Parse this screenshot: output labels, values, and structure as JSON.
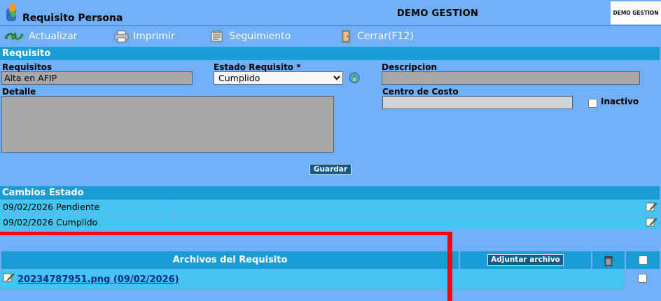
{
  "window": {
    "title": "Requisito Persona",
    "company": "DEMO GESTION",
    "brand": "DEMO GESTION"
  },
  "toolbar": {
    "update_label": "Actualizar",
    "print_label": "Imprimir",
    "follow_label": "Seguimiento",
    "close_label": "Cerrar(F12)"
  },
  "requisito": {
    "section_title": "Requisito",
    "requisitos_label": "Requisitos",
    "requisitos_value": "Alta en AFIP",
    "estado_label": "Estado Requisito *",
    "estado_value": "Cumplido",
    "descripcion_label": "Descripcion",
    "descripcion_value": "",
    "detalle_label": "Detalle",
    "detalle_value": "",
    "centro_label": "Centro de Costo",
    "centro_value": "",
    "inactivo_label": "Inactivo",
    "save_label": "Guardar"
  },
  "cambios": {
    "section_title": "Cambios Estado",
    "rows": [
      {
        "text": "09/02/2026 Pendiente"
      },
      {
        "text": "09/02/2026 Cumplido"
      }
    ]
  },
  "archivos": {
    "header": "Archivos del Requisito",
    "attach_label": "Adjuntar archivo",
    "files": [
      {
        "name": "20234787951.png (09/02/2026)"
      }
    ]
  },
  "colors": {
    "background": "#6fb0f7",
    "section": "#1a9cd4",
    "row": "#44c4ee",
    "button": "#0e5a8a",
    "highlight": "#ff0000"
  }
}
